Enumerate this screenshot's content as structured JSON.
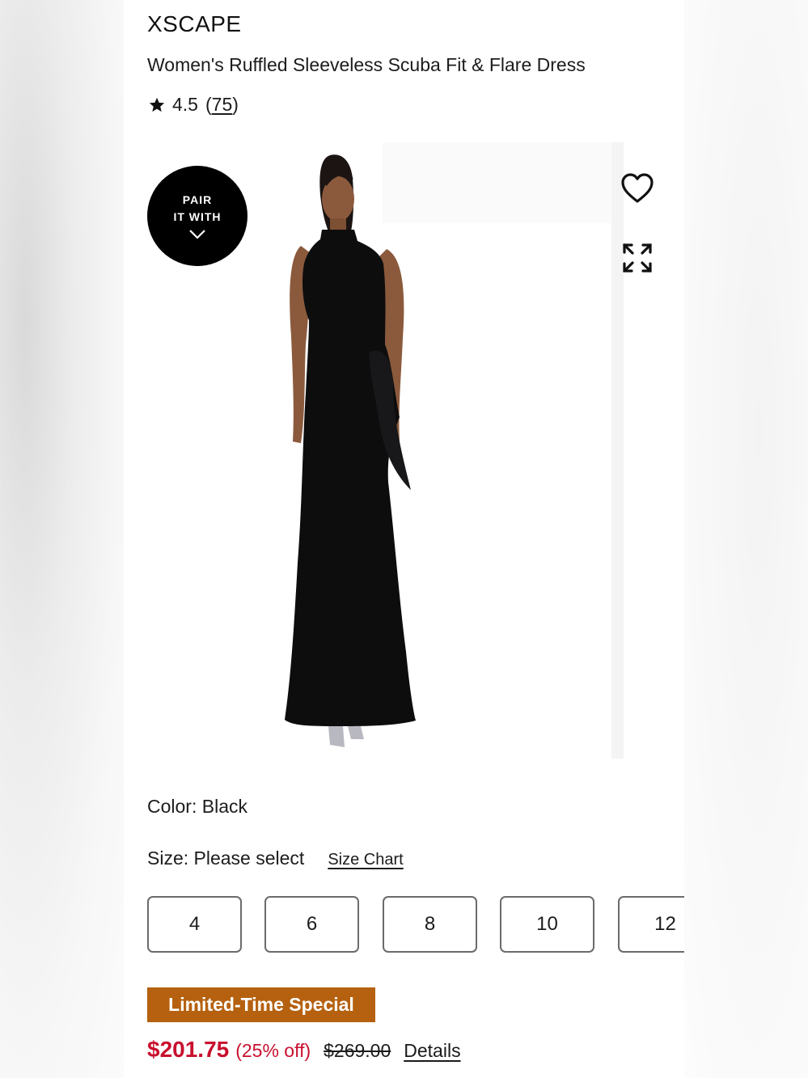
{
  "product": {
    "brand": "XSCAPE",
    "title": "Women's Ruffled Sleeveless Scuba Fit & Flare Dress",
    "rating": "4.5",
    "review_count": "(75)",
    "review_count_number": "75"
  },
  "gallery": {
    "pair_badge_line1": "PAIR",
    "pair_badge_line2": "IT WITH",
    "icons": [
      "heart-icon",
      "expand-icon",
      "chevron-down-icon"
    ]
  },
  "color": {
    "label": "Color: Black"
  },
  "size": {
    "label": "Size: Please select",
    "chart_link": "Size Chart",
    "options": [
      "4",
      "6",
      "8",
      "10",
      "12"
    ]
  },
  "promo": {
    "badge": "Limited-Time Special",
    "badge_color": "#b5610f"
  },
  "price": {
    "sale": "$201.75",
    "discount": "(25% off)",
    "original": "$269.00",
    "details_link": "Details",
    "sale_color": "#c8102e"
  }
}
